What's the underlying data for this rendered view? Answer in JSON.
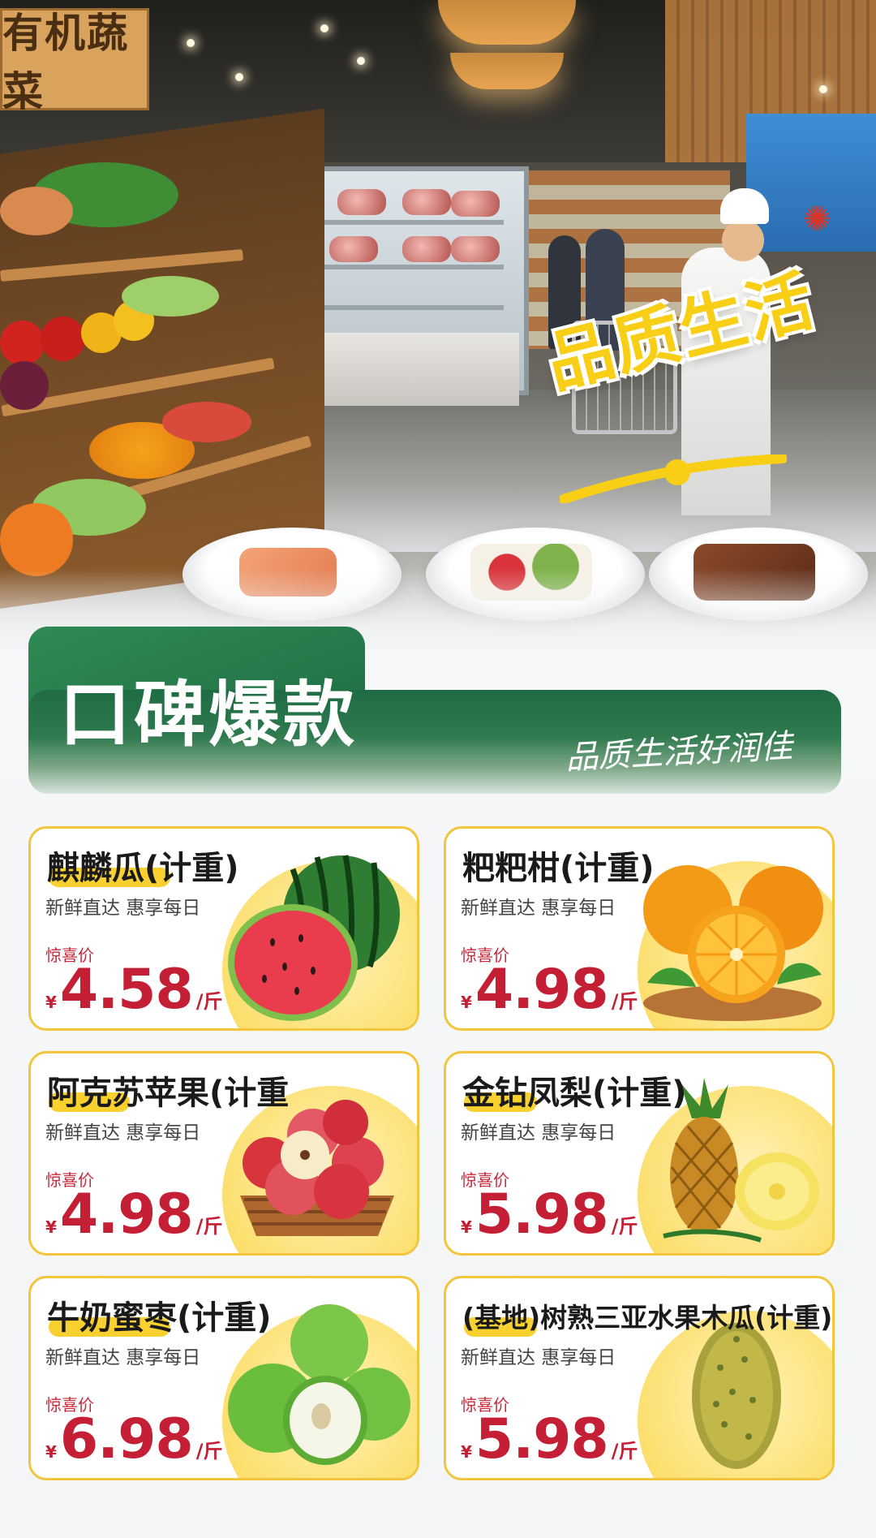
{
  "hero": {
    "store_sign": "有机蔬菜",
    "slogan": "品质生活"
  },
  "banner": {
    "title": "口碑爆款",
    "subtitle": "品质生活好润佳"
  },
  "products": [
    {
      "name": "麒麟瓜(计重)",
      "tagline": "新鲜直达 惠享每日",
      "price_label": "惊喜价",
      "currency": "¥",
      "price": "4.58",
      "unit": "/斤",
      "image": "watermelon-icon"
    },
    {
      "name": "粑粑柑(计重)",
      "tagline": "新鲜直达 惠享每日",
      "price_label": "惊喜价",
      "currency": "¥",
      "price": "4.98",
      "unit": "/斤",
      "image": "orange-icon"
    },
    {
      "name": "阿克苏苹果(计重",
      "tagline": "新鲜直达 惠享每日",
      "price_label": "惊喜价",
      "currency": "¥",
      "price": "4.98",
      "unit": "/斤",
      "image": "apple-basket-icon"
    },
    {
      "name": "金钻凤梨(计重)",
      "tagline": "新鲜直达 惠享每日",
      "price_label": "惊喜价",
      "currency": "¥",
      "price": "5.98",
      "unit": "/斤",
      "image": "pineapple-icon"
    },
    {
      "name": "牛奶蜜枣(计重)",
      "tagline": "新鲜直达 惠享每日",
      "price_label": "惊喜价",
      "currency": "¥",
      "price": "6.98",
      "unit": "/斤",
      "image": "green-jujube-icon"
    },
    {
      "name": "(基地)树熟三亚水果木瓜(计重)",
      "tagline": "新鲜直达 惠享每日",
      "price_label": "惊喜价",
      "currency": "¥",
      "price": "5.98",
      "unit": "/斤",
      "image": "papaya-icon"
    }
  ],
  "colors": {
    "accent_yellow": "#f8d130",
    "price_red": "#c41f34",
    "banner_green": "#1f6b43"
  }
}
